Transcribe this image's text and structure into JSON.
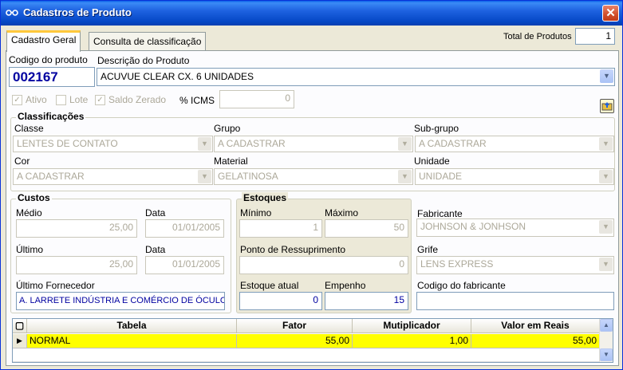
{
  "window": {
    "title": "Cadastros de Produto"
  },
  "tabs": [
    {
      "label": "Cadastro Geral",
      "active": true
    },
    {
      "label": "Consulta de classificação",
      "active": false
    }
  ],
  "total_produtos": {
    "label": "Total de Produtos",
    "value": "1"
  },
  "produto": {
    "codigo_label": "Codigo do produto",
    "codigo_value": "002167",
    "descricao_label": "Descrição do Produto",
    "descricao_value": "ACUVUE  CLEAR CX. 6 UNIDADES"
  },
  "flags": {
    "ativo": {
      "label": "Ativo",
      "checked": true
    },
    "lote": {
      "label": "Lote",
      "checked": false
    },
    "saldo_zerado": {
      "label": "Saldo Zerado",
      "checked": true
    }
  },
  "icms": {
    "label": "% ICMS",
    "value": "0"
  },
  "classificacoes": {
    "title": "Classificações",
    "classe": {
      "label": "Classe",
      "value": "LENTES DE CONTATO"
    },
    "grupo": {
      "label": "Grupo",
      "value": "A CADASTRAR"
    },
    "subgrupo": {
      "label": "Sub-grupo",
      "value": "A CADASTRAR"
    },
    "cor": {
      "label": "Cor",
      "value": "A CADASTRAR"
    },
    "material": {
      "label": "Material",
      "value": "GELATINOSA"
    },
    "unidade": {
      "label": "Unidade",
      "value": "UNIDADE"
    }
  },
  "custos": {
    "title": "Custos",
    "medio_label": "Médio",
    "medio_value": "25,00",
    "data1_label": "Data",
    "data1_value": "01/01/2005",
    "ultimo_label": "Último",
    "ultimo_value": "25,00",
    "data2_label": "Data",
    "data2_value": "01/01/2005",
    "fornecedor_label": "Último Fornecedor",
    "fornecedor_value": "A. LARRETE INDÚSTRIA E COMÉRCIO DE ÓCULOS LT"
  },
  "estoques": {
    "title": "Estoques",
    "minimo_label": "Mínimo",
    "minimo_value": "1",
    "maximo_label": "Máximo",
    "maximo_value": "50",
    "ressuprimento_label": "Ponto de Ressuprimento",
    "ressuprimento_value": "0",
    "atual_label": "Estoque atual",
    "atual_value": "0",
    "empenho_label": "Empenho",
    "empenho_value": "15"
  },
  "fabricante": {
    "fabricante_label": "Fabricante",
    "fabricante_value": "JOHNSON & JONHSON",
    "grife_label": "Grife",
    "grife_value": "LENS EXPRESS",
    "codigo_label": "Codigo do fabricante",
    "codigo_value": ""
  },
  "tabela": {
    "columns": [
      "Tabela",
      "Fator",
      "Mutiplicador",
      "Valor em Reais"
    ],
    "rows": [
      {
        "tabela": "NORMAL",
        "fator": "55,00",
        "multiplicador": "1,00",
        "valor": "55,00"
      }
    ]
  },
  "colors": {
    "title_bar": "#0A5FE8",
    "selected_row": "#FFFF00",
    "tab_highlight": "#FFC83C"
  },
  "icons": {
    "app": "glasses-icon",
    "close": "close-icon",
    "action": "folder-up-icon"
  }
}
